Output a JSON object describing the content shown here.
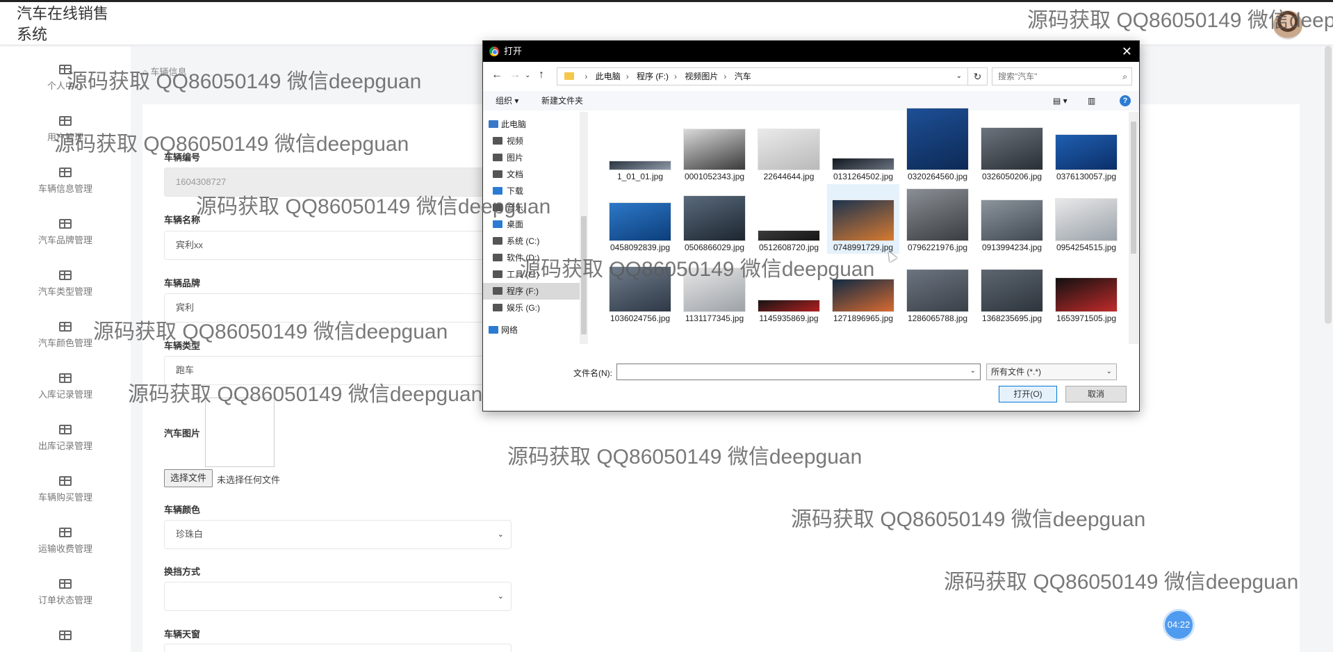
{
  "app": {
    "title": "汽车在线销售系统"
  },
  "sidebar": {
    "items": [
      {
        "label": "个人中心"
      },
      {
        "label": "用户管理"
      },
      {
        "label": "车辆信息管理"
      },
      {
        "label": "汽车品牌管理"
      },
      {
        "label": "汽车类型管理"
      },
      {
        "label": "汽车颜色管理"
      },
      {
        "label": "入库记录管理"
      },
      {
        "label": "出库记录管理"
      },
      {
        "label": "车辆购买管理"
      },
      {
        "label": "运输收费管理"
      },
      {
        "label": "订单状态管理"
      }
    ]
  },
  "breadcrumb": {
    "icon": "home-icon",
    "current": "车辆信息"
  },
  "form": {
    "car_no": {
      "label": "车辆编号",
      "value": "1604308727"
    },
    "car_name": {
      "label": "车辆名称",
      "value": "宾利xx"
    },
    "brand": {
      "label": "车辆品牌",
      "value": "宾利"
    },
    "type": {
      "label": "车辆类型",
      "value": "跑车"
    },
    "picture": {
      "label": "汽车图片",
      "button": "选择文件",
      "status": "未选择任何文件"
    },
    "color": {
      "label": "车辆颜色",
      "value": "珍珠白"
    },
    "gear": {
      "label": "换挡方式",
      "value": ""
    },
    "sunroof": {
      "label": "车辆天窗"
    }
  },
  "timer": {
    "label": "04:22"
  },
  "watermark": "源码获取 QQ86050149 微信deepguan",
  "dialog": {
    "title": "打开",
    "path": [
      "此电脑",
      "程序 (F:)",
      "视频图片",
      "汽车"
    ],
    "search_placeholder": "搜索\"汽车\"",
    "toolbar": {
      "organize": "组织 ▾",
      "new_folder": "新建文件夹"
    },
    "tree": [
      {
        "label": "此电脑",
        "icon": "computer-icon",
        "color": "#3a78c9"
      },
      {
        "label": "视频",
        "icon": "video-folder-icon",
        "color": "#555555"
      },
      {
        "label": "图片",
        "icon": "picture-folder-icon",
        "color": "#555555"
      },
      {
        "label": "文档",
        "icon": "document-folder-icon",
        "color": "#555555"
      },
      {
        "label": "下载",
        "icon": "download-folder-icon",
        "color": "#2b7bd3"
      },
      {
        "label": "音乐",
        "icon": "music-folder-icon",
        "color": "#555555"
      },
      {
        "label": "桌面",
        "icon": "desktop-folder-icon",
        "color": "#2b7bd3"
      },
      {
        "label": "系统 (C:)",
        "icon": "drive-icon",
        "color": "#555555"
      },
      {
        "label": "软件 (D:)",
        "icon": "drive-icon",
        "color": "#555555"
      },
      {
        "label": "工具 (E:)",
        "icon": "drive-icon",
        "color": "#555555"
      },
      {
        "label": "程序 (F:)",
        "icon": "drive-icon",
        "color": "#555555"
      },
      {
        "label": "娱乐 (G:)",
        "icon": "drive-icon",
        "color": "#555555"
      },
      {
        "label": "网络",
        "icon": "network-icon",
        "color": "#2b7bd3"
      }
    ],
    "files": [
      "1_01_01.jpg",
      "0001052343.jpg",
      "22644644.jpg",
      "0131264502.jpg",
      "0320264560.jpg",
      "0326050206.jpg",
      "0376130057.jpg",
      "0458092839.jpg",
      "0506866029.jpg",
      "0512608720.jpg",
      "0748991729.jpg",
      "0796221976.jpg",
      "0913994234.jpg",
      "0954254515.jpg",
      "1036024756.jpg",
      "1131177345.jpg",
      "1145935869.jpg",
      "1271896965.jpg",
      "1286065788.jpg",
      "1368235695.jpg",
      "1653971505.jpg"
    ],
    "thumb_colors": [
      [
        "#2b3542",
        "#8f9aa8"
      ],
      [
        "#d9d9d9",
        "#3a3a3a"
      ],
      [
        "#eaeaea",
        "#b9b9b9"
      ],
      [
        "#121820",
        "#6a7380"
      ],
      [
        "#1d4f96",
        "#0d2a56"
      ],
      [
        "#6b737c",
        "#2a2f36"
      ],
      [
        "#1f5fb0",
        "#0b2f6a"
      ],
      [
        "#2d78c8",
        "#0c3e7a"
      ],
      [
        "#5a6a7c",
        "#1d2630"
      ],
      [
        "#3a3a3a",
        "#151515"
      ],
      [
        "#1b3350",
        "#d87a30"
      ],
      [
        "#8a8f95",
        "#3a3d41"
      ],
      [
        "#8c949c",
        "#404852"
      ],
      [
        "#e8e8e8",
        "#9aa2aa"
      ],
      [
        "#707d8c",
        "#2e3846"
      ],
      [
        "#e6e6e6",
        "#9da2a8"
      ],
      [
        "#151515",
        "#b32020"
      ],
      [
        "#0f2a44",
        "#d86a30"
      ],
      [
        "#6b7480",
        "#3a4048"
      ],
      [
        "#5d6670",
        "#2d343c"
      ],
      [
        "#111111",
        "#c22a2a"
      ]
    ],
    "filename_label": "文件名(N):",
    "filename_value": "",
    "filetype": "所有文件 (*.*)",
    "open_button": "打开(O)",
    "cancel_button": "取消"
  }
}
